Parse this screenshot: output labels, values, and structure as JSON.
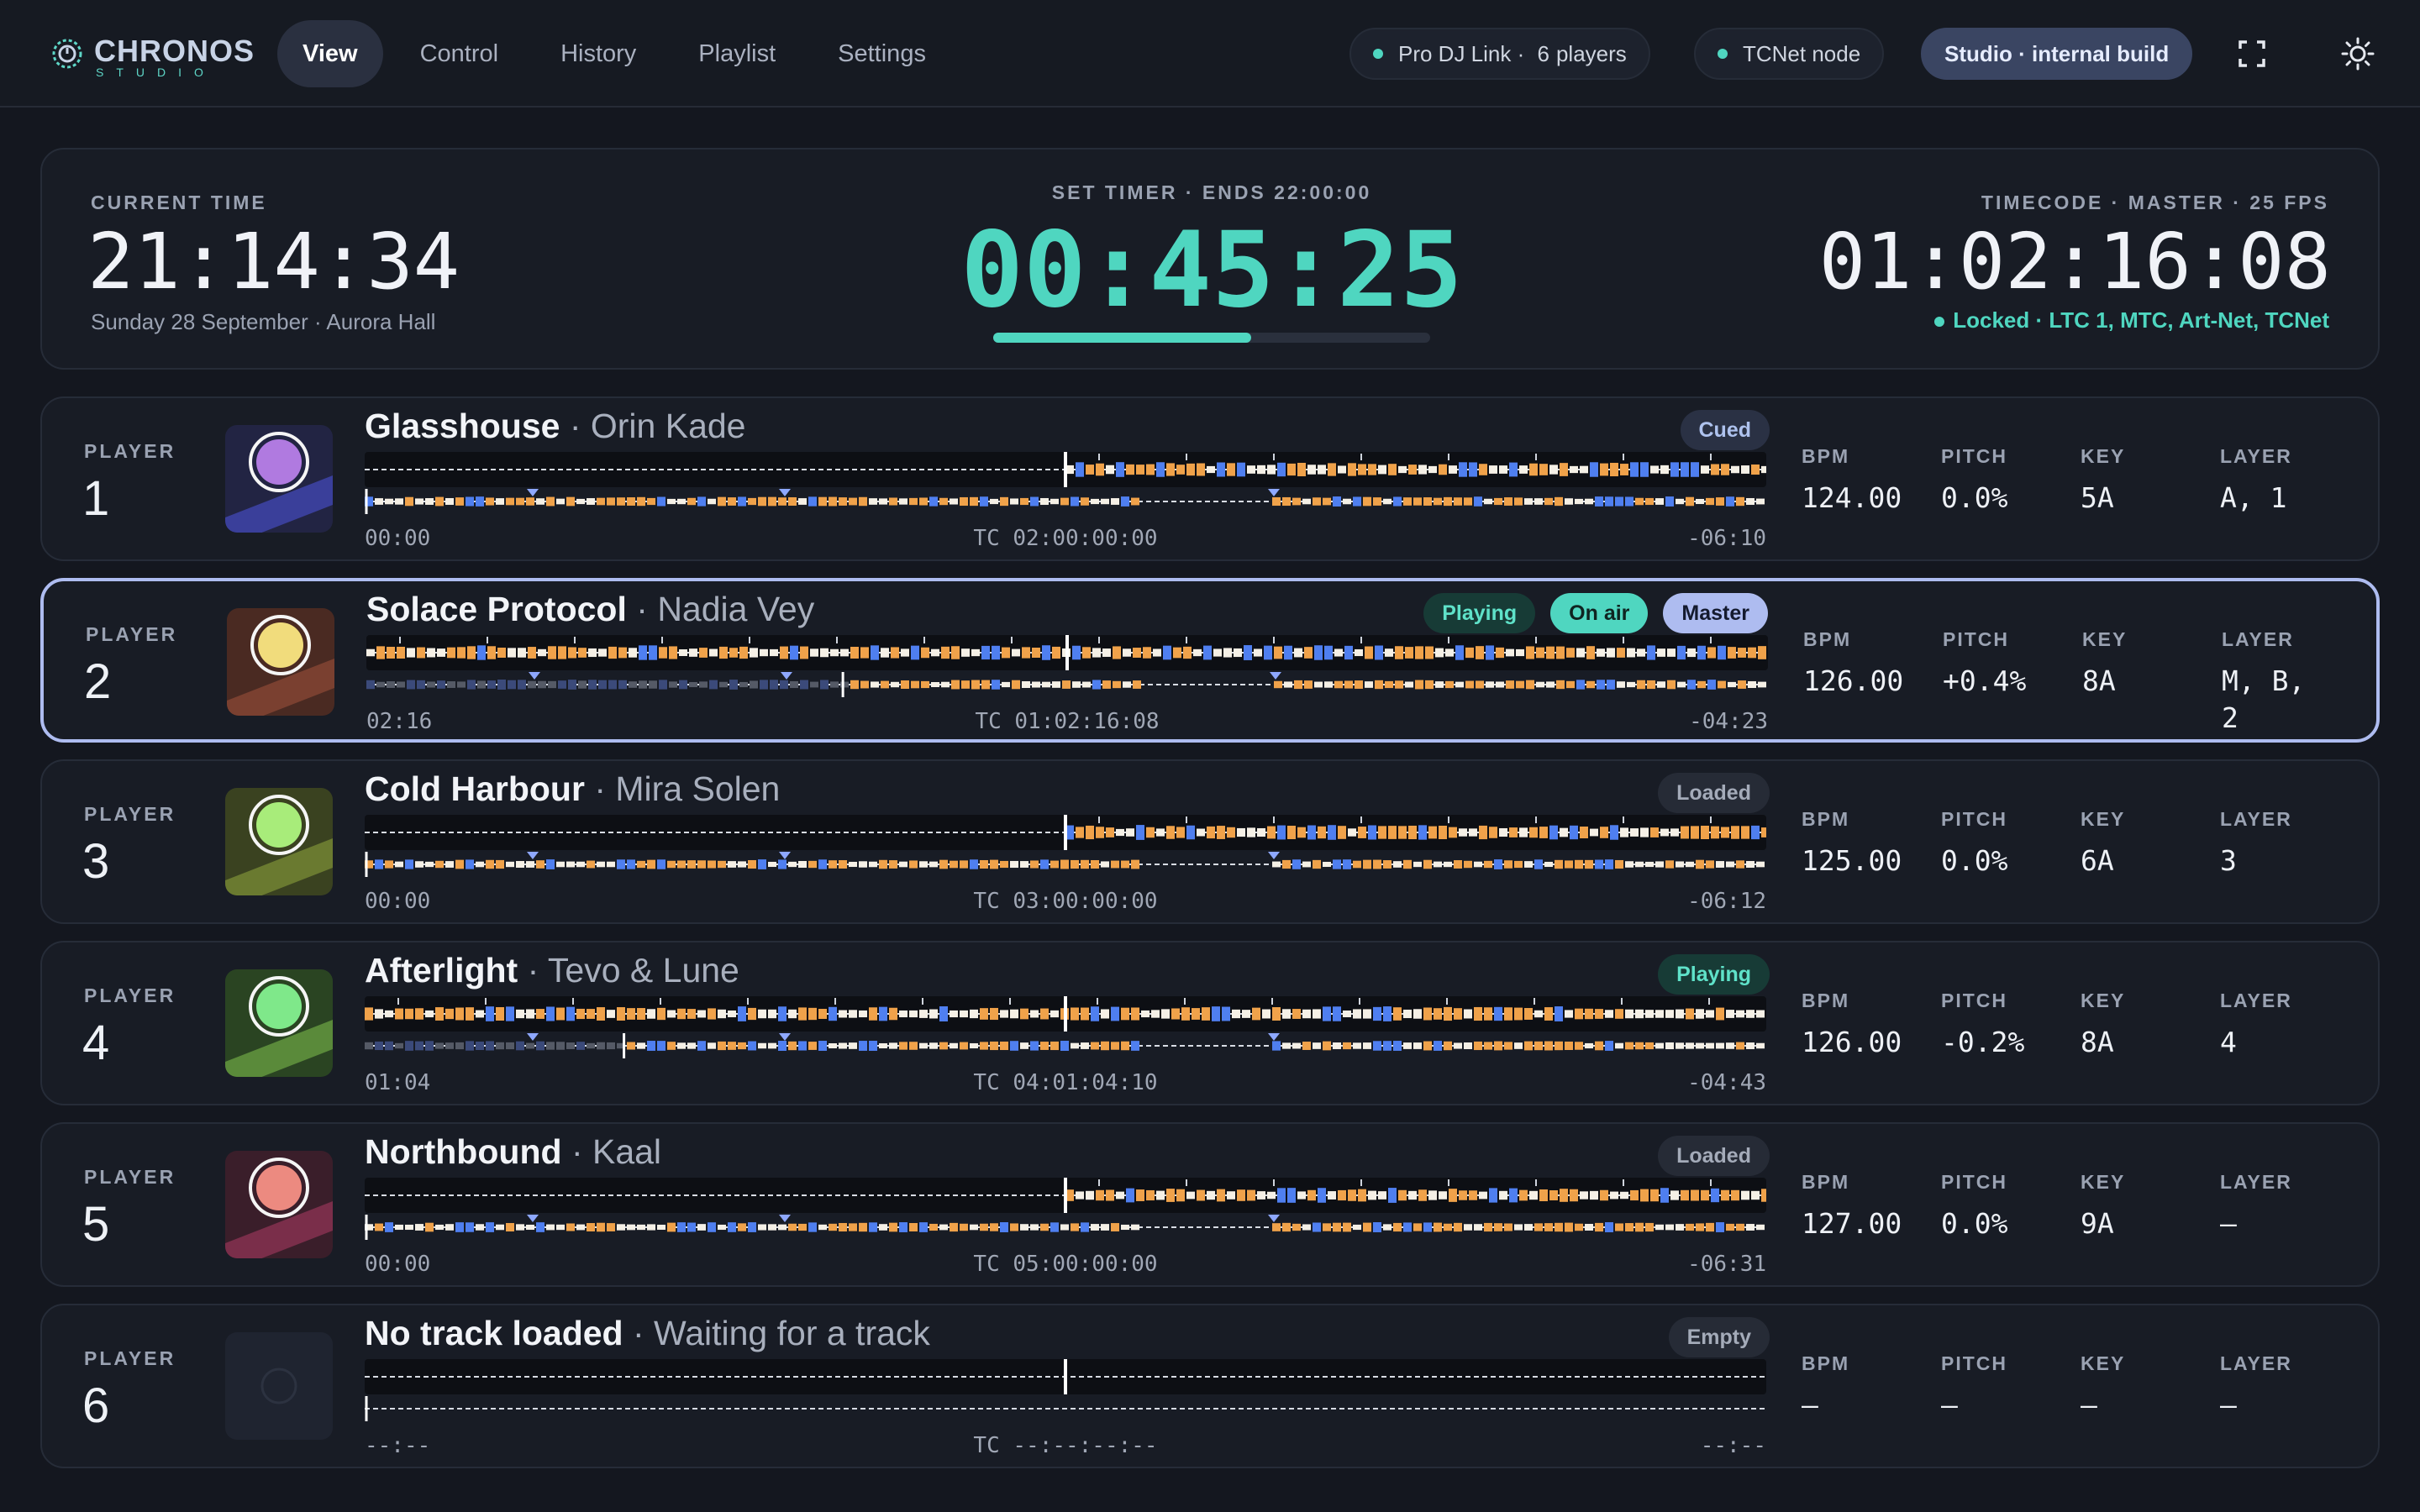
{
  "app": {
    "brand": "CHRONOS",
    "brand_sub": "STUDIO"
  },
  "nav": [
    "View",
    "Control",
    "History",
    "Playlist",
    "Settings"
  ],
  "status": {
    "prodj_prefix": "Pro DJ Link ·",
    "prodj_count": "6",
    "prodj_suffix": "players",
    "tcnet": "TCNet node",
    "build": "Studio · internal build"
  },
  "timers": {
    "current_label": "CURRENT TIME",
    "current_time": "21:14:34",
    "current_sub": "Sunday 28 September · Aurora Hall",
    "set_label": "SET TIMER · ENDS 22:00:00",
    "set_time": "00:45:25",
    "set_progress": 0.59,
    "tc_label": "TIMECODE · MASTER · 25 FPS",
    "tc_time": "01:02:16:08",
    "tc_status": "Locked · LTC 1, MTC, Art-Net, TCNet"
  },
  "colors": {
    "accent": "#4fd6c0",
    "master": "#aebcf0",
    "wave_orange": "#f0a24a",
    "wave_blue": "#4f7ff0"
  },
  "stat_labels": {
    "bpm": "BPM",
    "pitch": "PITCH",
    "key": "KEY",
    "layer": "LAYER"
  },
  "player_label": "PLAYER",
  "players": [
    {
      "num": "1",
      "track": "Glasshouse",
      "artist": "· Orin Kade",
      "badges": [
        {
          "text": "Cued",
          "kind": "cued"
        }
      ],
      "elapsed": "00:00",
      "tc": "TC 02:00:00:00",
      "remain": "-06:10",
      "progress": 0.0,
      "bpm": "124.00",
      "pitch": "0.0%",
      "key": "5A",
      "layer": "A, 1",
      "art": {
        "bg": "#222443",
        "band": "#3a3f9a",
        "circle": "#b07ae0"
      }
    },
    {
      "num": "2",
      "track": "Solace Protocol",
      "artist": "· Nadia Vey",
      "badges": [
        {
          "text": "Playing",
          "kind": "playing"
        },
        {
          "text": "On air",
          "kind": "onair"
        },
        {
          "text": "Master",
          "kind": "master"
        }
      ],
      "elapsed": "02:16",
      "tc": "TC 01:02:16:08",
      "remain": "-04:23",
      "progress": 0.34,
      "master": true,
      "bpm": "126.00",
      "pitch": "+0.4%",
      "key": "8A",
      "layer": "M, B, 2",
      "art": {
        "bg": "#4a2a22",
        "band": "#7a4030",
        "circle": "#f1dc7c"
      }
    },
    {
      "num": "3",
      "track": "Cold Harbour",
      "artist": "· Mira Solen",
      "badges": [
        {
          "text": "Loaded",
          "kind": "loaded"
        }
      ],
      "elapsed": "00:00",
      "tc": "TC 03:00:00:00",
      "remain": "-06:12",
      "progress": 0.0,
      "bpm": "125.00",
      "pitch": "0.0%",
      "key": "6A",
      "layer": "3",
      "art": {
        "bg": "#3a4220",
        "band": "#6a7a30",
        "circle": "#a8ec7a"
      }
    },
    {
      "num": "4",
      "track": "Afterlight",
      "artist": "· Tevo & Lune",
      "badges": [
        {
          "text": "Playing",
          "kind": "playing"
        }
      ],
      "elapsed": "01:04",
      "tc": "TC 04:01:04:10",
      "remain": "-04:43",
      "progress": 0.185,
      "bpm": "126.00",
      "pitch": "-0.2%",
      "key": "8A",
      "layer": "4",
      "art": {
        "bg": "#2a4422",
        "band": "#5a8a3a",
        "circle": "#7fe88a"
      }
    },
    {
      "num": "5",
      "track": "Northbound",
      "artist": "· Kaal",
      "badges": [
        {
          "text": "Loaded",
          "kind": "loaded"
        }
      ],
      "elapsed": "00:00",
      "tc": "TC 05:00:00:00",
      "remain": "-06:31",
      "progress": 0.0,
      "bpm": "127.00",
      "pitch": "0.0%",
      "key": "9A",
      "layer": "–",
      "art": {
        "bg": "#3a1e2a",
        "band": "#7a2e4a",
        "circle": "#ec8a80"
      }
    },
    {
      "num": "6",
      "track": "No track loaded",
      "artist": "· Waiting for a track",
      "badges": [
        {
          "text": "Empty",
          "kind": "empty"
        }
      ],
      "elapsed": "--:--",
      "tc": "TC --:--:--:--",
      "remain": "--:--",
      "progress": 0.0,
      "empty": true,
      "bpm": "–",
      "pitch": "–",
      "key": "–",
      "layer": "–",
      "art": {
        "bg": "#1f2430",
        "band": "#1f2430",
        "circle": "none"
      }
    }
  ]
}
